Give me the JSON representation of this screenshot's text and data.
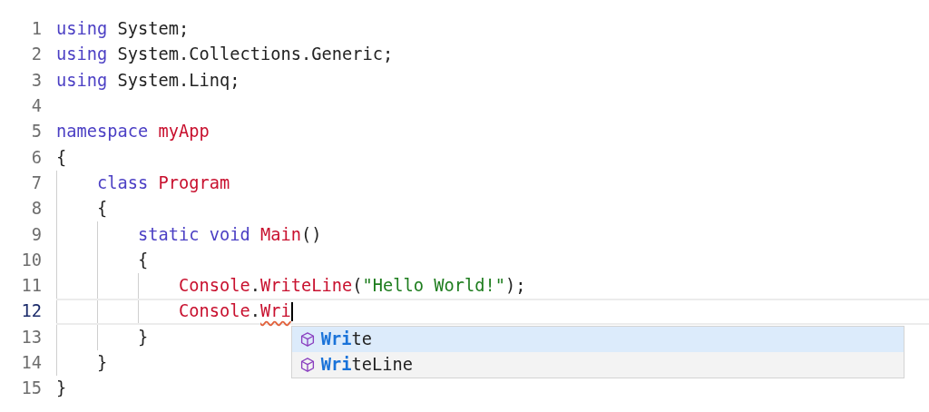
{
  "editor": {
    "lines": [
      {
        "number": "1",
        "current": false,
        "tokens": [
          {
            "text": "using",
            "kind": "keyword"
          },
          {
            "text": " System;",
            "kind": "plain"
          }
        ]
      },
      {
        "number": "2",
        "current": false,
        "tokens": [
          {
            "text": "using",
            "kind": "keyword"
          },
          {
            "text": " System.Collections.Generic;",
            "kind": "plain"
          }
        ]
      },
      {
        "number": "3",
        "current": false,
        "tokens": [
          {
            "text": "using",
            "kind": "keyword"
          },
          {
            "text": " System.Linq;",
            "kind": "plain"
          }
        ]
      },
      {
        "number": "4",
        "current": false
      },
      {
        "number": "5",
        "current": false,
        "tokens": [
          {
            "text": "namespace",
            "kind": "keyword"
          },
          {
            "text": " myApp",
            "kind": "name"
          }
        ]
      },
      {
        "number": "6",
        "current": false,
        "tokens": [
          {
            "text": "{",
            "kind": "plain"
          }
        ]
      },
      {
        "number": "7",
        "current": false,
        "tokens": [
          {
            "text": "    class",
            "kind": "keyword"
          },
          {
            "text": " Program",
            "kind": "name"
          }
        ]
      },
      {
        "number": "8",
        "current": false,
        "tokens": [
          {
            "text": "    {",
            "kind": "plain"
          }
        ]
      },
      {
        "number": "9",
        "current": false,
        "tokens": [
          {
            "text": "        static void",
            "kind": "keyword"
          },
          {
            "text": " Main",
            "kind": "name"
          },
          {
            "text": "()",
            "kind": "plain"
          }
        ]
      },
      {
        "number": "10",
        "current": false,
        "tokens": [
          {
            "text": "        {",
            "kind": "plain"
          }
        ]
      },
      {
        "number": "11",
        "current": false,
        "tokens": [
          {
            "text": "            Console",
            "kind": "name"
          },
          {
            "text": ".",
            "kind": "plain"
          },
          {
            "text": "WriteLine",
            "kind": "name"
          },
          {
            "text": "(",
            "kind": "plain"
          },
          {
            "text": "\"Hello World!\"",
            "kind": "string"
          },
          {
            "text": ");",
            "kind": "plain"
          }
        ]
      },
      {
        "number": "12",
        "current": true,
        "tokens": [
          {
            "text": "            Console",
            "kind": "name"
          },
          {
            "text": ".",
            "kind": "plain"
          },
          {
            "text": "Wri",
            "kind": "name",
            "error": true
          }
        ]
      },
      {
        "number": "13",
        "current": false,
        "tokens": [
          {
            "text": "        }",
            "kind": "plain"
          }
        ]
      },
      {
        "number": "14",
        "current": false,
        "tokens": [
          {
            "text": "    }",
            "kind": "plain"
          }
        ]
      },
      {
        "number": "15",
        "current": false,
        "tokens": [
          {
            "text": "}",
            "kind": "plain"
          }
        ]
      }
    ]
  },
  "suggestions": [
    {
      "label": "**Wri**te",
      "selected": true
    },
    {
      "label": "**Wri**teLine",
      "selected": false
    }
  ]
}
